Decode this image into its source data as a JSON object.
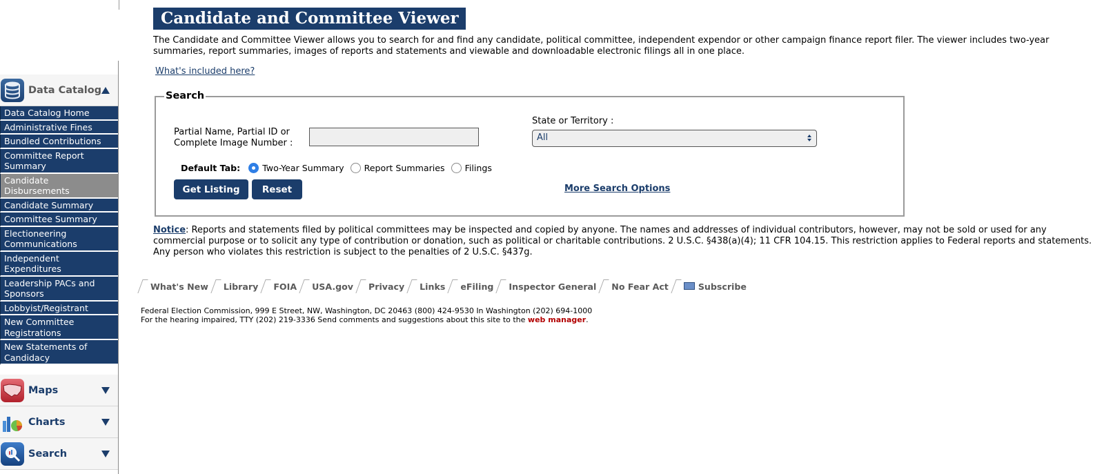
{
  "sidebar": {
    "catalog": {
      "title": "Data Catalog",
      "icon": "database-icon",
      "expanded": true
    },
    "items": [
      {
        "label": "Data Catalog Home",
        "active": false
      },
      {
        "label": "Administrative Fines",
        "active": false
      },
      {
        "label": "Bundled Contributions",
        "active": false
      },
      {
        "label": "Committee Report Summary",
        "active": false
      },
      {
        "label": "Candidate Disbursements",
        "active": true
      },
      {
        "label": "Candidate Summary",
        "active": false
      },
      {
        "label": "Committee Summary",
        "active": false
      },
      {
        "label": "Electioneering Communications",
        "active": false
      },
      {
        "label": "Independent Expenditures",
        "active": false
      },
      {
        "label": "Leadership PACs and Sponsors",
        "active": false
      },
      {
        "label": "Lobbyist/Registrant",
        "active": false
      },
      {
        "label": "New Committee Registrations",
        "active": false
      },
      {
        "label": "New Statements of Candidacy",
        "active": false
      }
    ],
    "sections": [
      {
        "title": "Maps",
        "icon": "us-map-icon"
      },
      {
        "title": "Charts",
        "icon": "pie-chart-icon"
      },
      {
        "title": "Search",
        "icon": "magnifier-icon"
      }
    ]
  },
  "main": {
    "title": "Candidate and Committee Viewer",
    "intro": "The Candidate and Committee Viewer allows you to search for and find any candidate, political committee, independent expendor or other campaign finance report filer. The viewer includes two-year summaries, report summaries, images of reports and statements and viewable and downloadable electronic filings all in one place.",
    "whats_included": "What's included here?"
  },
  "search": {
    "legend": "Search",
    "name_label_1": "Partial Name, Partial ID or",
    "name_label_2": "Complete Image Number :",
    "name_value": "",
    "state_label": "State or Territory :",
    "state_value": "All",
    "default_tab_label": "Default Tab:",
    "tabs": [
      {
        "label": "Two-Year Summary",
        "checked": true
      },
      {
        "label": "Report Summaries",
        "checked": false
      },
      {
        "label": "Filings",
        "checked": false
      }
    ],
    "get_listing": "Get Listing",
    "reset": "Reset",
    "more_options": "More Search Options"
  },
  "notice": {
    "link": "Notice",
    "text": ": Reports and statements filed by political committees may be inspected and copied by anyone. The names and addresses of individual contributors, however, may not be sold or used for any commercial purpose or to solicit any type of contribution or donation, such as political or charitable contributions. 2 U.S.C. §438(a)(4); 11 CFR 104.15. This restriction applies to Federal reports and statements. Any person who violates this restriction is subject to the penalties of 2 U.S.C. §437g."
  },
  "footer": {
    "nav": [
      "What's New",
      "Library",
      "FOIA",
      "USA.gov",
      "Privacy",
      "Links",
      "eFiling",
      "Inspector General",
      "No Fear Act",
      "Subscribe"
    ],
    "line1": "Federal Election Commission, 999 E Street, NW, Washington, DC 20463 (800) 424-9530 In Washington (202) 694-1000",
    "line2": "For the hearing impaired, TTY (202) 219-3336 Send comments and suggestions about this site to the ",
    "webmanager": "web manager",
    "line2_end": "."
  },
  "colors": {
    "brand_navy": "#1b3d6b",
    "active_item": "#8c8c8c",
    "link_red": "#b20000"
  }
}
